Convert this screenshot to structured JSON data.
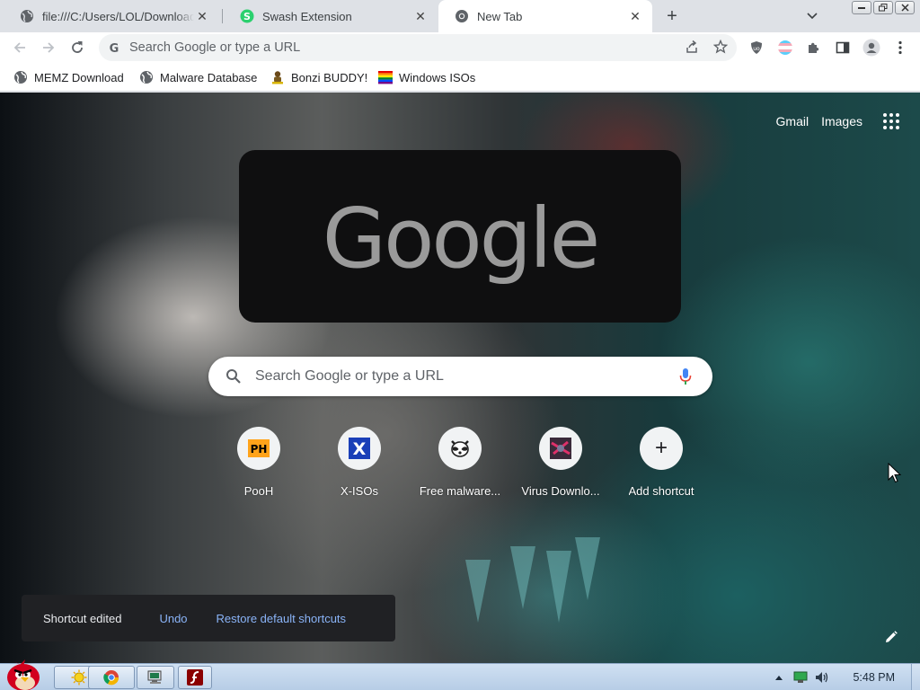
{
  "tabs": [
    {
      "title": "file:///C:/Users/LOL/Downloads/",
      "icon": "globe-icon",
      "active": false
    },
    {
      "title": "Swash Extension",
      "icon": "swash-icon",
      "active": false
    },
    {
      "title": "New Tab",
      "icon": "chrome-icon",
      "active": true
    }
  ],
  "omnibox": {
    "placeholder": "Search Google or type a URL"
  },
  "bookmarks": [
    {
      "label": "MEMZ Download",
      "icon": "globe-icon"
    },
    {
      "label": "Malware Database",
      "icon": "globe-icon"
    },
    {
      "label": "Bonzi BUDDY!",
      "icon": "bonzi-icon"
    },
    {
      "label": "Windows ISOs",
      "icon": "windows-flag-icon"
    }
  ],
  "ntp": {
    "gmail": "Gmail",
    "images": "Images",
    "logo": "Google",
    "search_placeholder": "Search Google or type a URL",
    "shortcuts": [
      {
        "label": "PooH",
        "icon_text": "PH"
      },
      {
        "label": "X-ISOs",
        "icon_text": "X"
      },
      {
        "label": "Free malware...",
        "icon_text": ""
      },
      {
        "label": "Virus Downlo...",
        "icon_text": ""
      },
      {
        "label": "Add shortcut",
        "icon_text": "+"
      }
    ],
    "toast": {
      "message": "Shortcut edited",
      "undo": "Undo",
      "restore": "Restore default shortcuts"
    }
  },
  "taskbar": {
    "clock": "5:48 PM"
  },
  "colors": {
    "toast_link": "#8ab4f8",
    "toast_bg": "#202124",
    "logo_box": "#0f0f10"
  }
}
